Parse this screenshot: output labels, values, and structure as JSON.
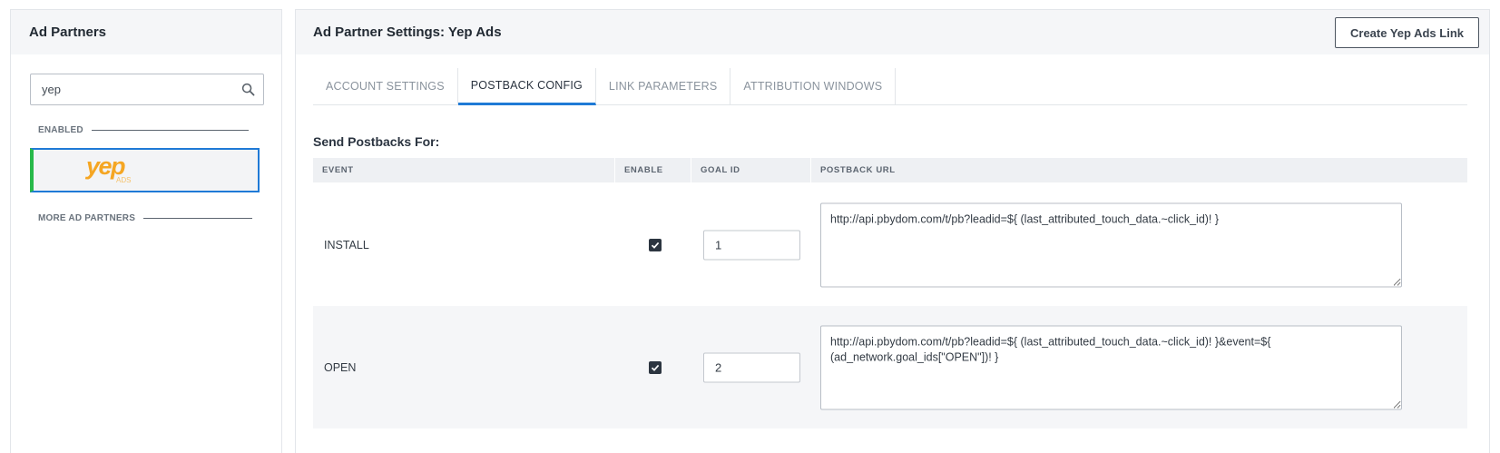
{
  "left": {
    "title": "Ad Partners",
    "search": {
      "value": "yep",
      "icon": "search-icon"
    },
    "enabled_label": "ENABLED",
    "partner": {
      "logo_text": "yep",
      "logo_subtext": "ADS",
      "logo_color": "#f5a623"
    },
    "more_label": "MORE AD PARTNERS"
  },
  "right": {
    "title": "Ad Partner Settings: Yep Ads",
    "create_button": "Create Yep Ads Link",
    "tabs": [
      {
        "label": "ACCOUNT SETTINGS",
        "active": false
      },
      {
        "label": "POSTBACK CONFIG",
        "active": true
      },
      {
        "label": "LINK PARAMETERS",
        "active": false
      },
      {
        "label": "ATTRIBUTION WINDOWS",
        "active": false
      }
    ],
    "section_title": "Send Postbacks For:",
    "table": {
      "headers": [
        "EVENT",
        "ENABLE",
        "GOAL ID",
        "POSTBACK URL"
      ],
      "rows": [
        {
          "event": "INSTALL",
          "enabled": true,
          "goal_id": "1",
          "url": "http://api.pbydom.com/t/pb?leadid=${ (last_attributed_touch_data.~click_id)! }"
        },
        {
          "event": "OPEN",
          "enabled": true,
          "goal_id": "2",
          "url": "http://api.pbydom.com/t/pb?leadid=${ (last_attributed_touch_data.~click_id)! }&event=${ (ad_network.goal_ids[\"OPEN\"])! }"
        }
      ]
    }
  },
  "colors": {
    "accent": "#1f7ad6",
    "enabled_bar": "#28b94a"
  }
}
